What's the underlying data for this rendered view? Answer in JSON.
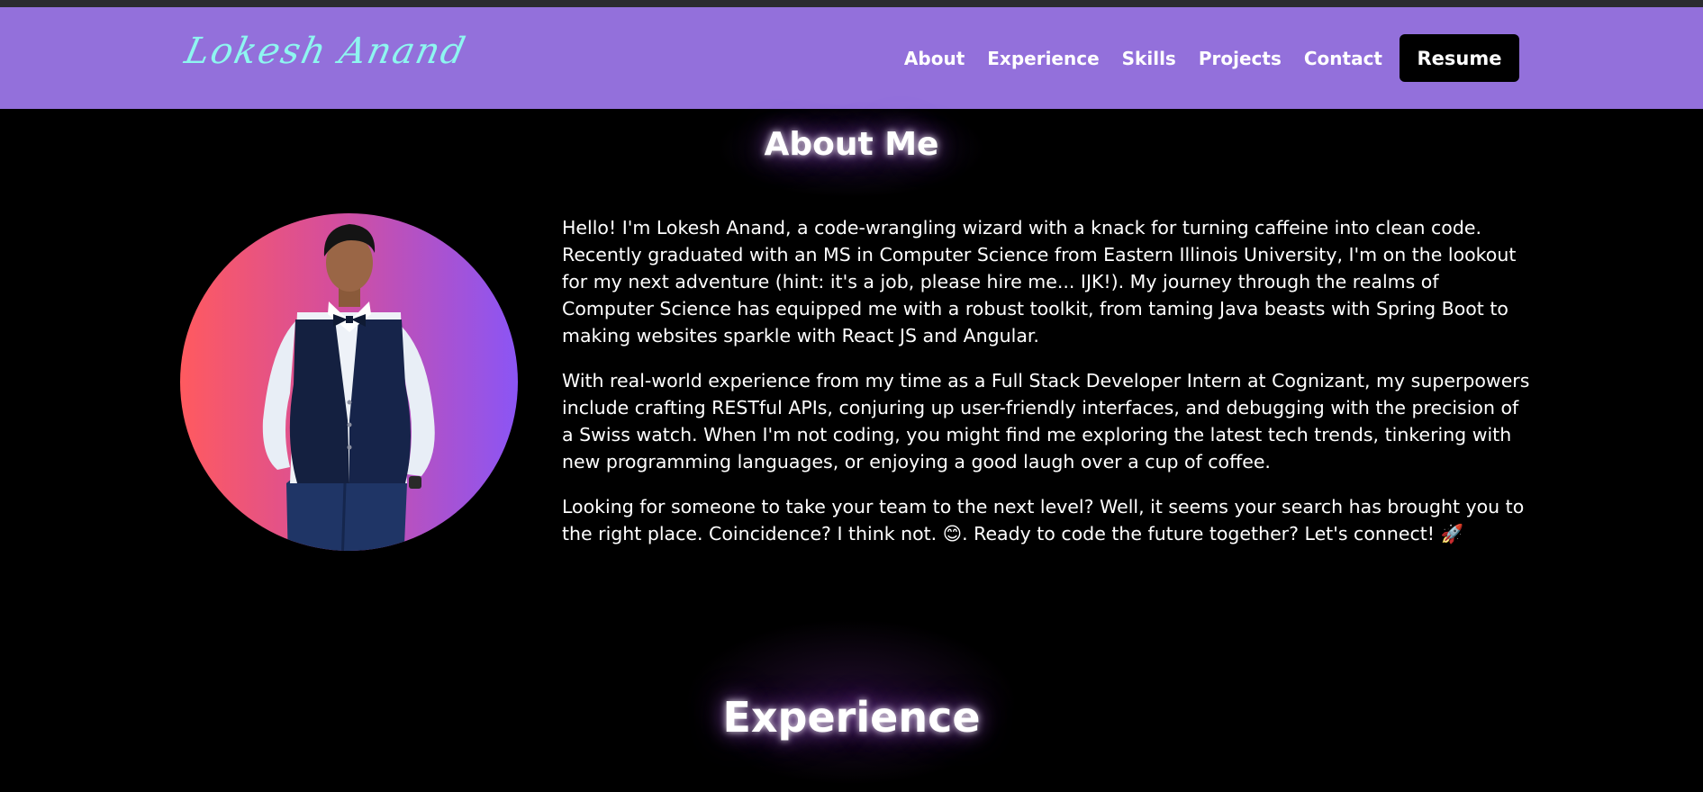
{
  "header": {
    "logo_text": "Lokesh Anand",
    "nav": [
      "About",
      "Experience",
      "Skills",
      "Projects",
      "Contact"
    ],
    "resume_label": "Resume",
    "colors": {
      "navbar_bg": "#9370DB",
      "logo": "#8EF6F0",
      "resume_bg": "#000000"
    }
  },
  "about": {
    "title": "About Me",
    "paragraphs": [
      "Hello! I'm Lokesh Anand, a code-wrangling wizard with a knack for turning caffeine into clean code. Recently graduated with an MS in Computer Science from Eastern Illinois University, I'm on the lookout for my next adventure (hint: it's a job, please hire me... IJK!). My journey through the realms of Computer Science has equipped me with a robust toolkit, from taming Java beasts with Spring Boot to making websites sparkle with React JS and Angular.",
      "With real-world experience from my time as a Full Stack Developer Intern at Cognizant, my superpowers include crafting RESTful APIs, conjuring up user-friendly interfaces, and debugging with the precision of a Swiss watch. When I'm not coding, you might find me exploring the latest tech trends, tinkering with new programming languages, or enjoying a good laugh over a cup of coffee.",
      "Looking for someone to take your team to the next level? Well, it seems your search has brought you to the right place. Coincidence? I think not. 😊. Ready to code the future together? Let's connect! 🚀"
    ],
    "avatar_gradient": [
      "#FF5A5F",
      "#D54E9C",
      "#8B55F5"
    ]
  },
  "experience": {
    "title": "Experience"
  }
}
